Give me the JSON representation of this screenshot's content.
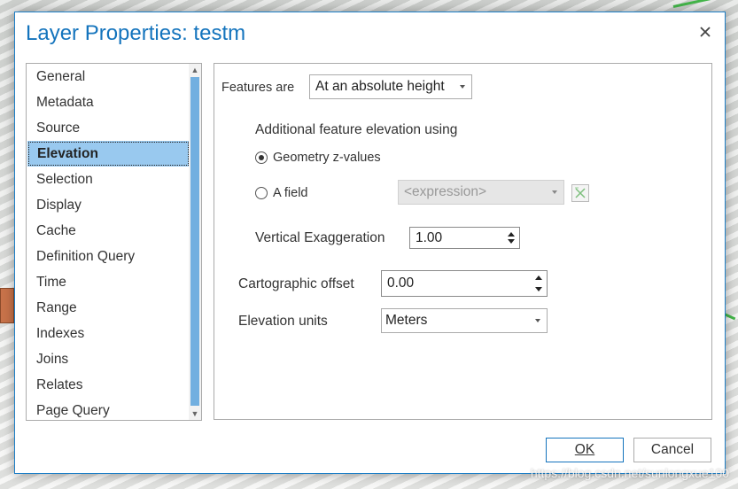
{
  "dialog": {
    "title": "Layer Properties: testm",
    "close_icon": "close-icon"
  },
  "nav": {
    "items": [
      {
        "label": "General"
      },
      {
        "label": "Metadata"
      },
      {
        "label": "Source"
      },
      {
        "label": "Elevation",
        "selected": true
      },
      {
        "label": "Selection"
      },
      {
        "label": "Display"
      },
      {
        "label": "Cache"
      },
      {
        "label": "Definition Query"
      },
      {
        "label": "Time"
      },
      {
        "label": "Range"
      },
      {
        "label": "Indexes"
      },
      {
        "label": "Joins"
      },
      {
        "label": "Relates"
      },
      {
        "label": "Page Query"
      }
    ]
  },
  "elevation": {
    "features_are_label": "Features are",
    "features_are_value": "At an absolute height",
    "additional_label": "Additional feature elevation using",
    "option_geometry": "Geometry z-values",
    "option_field": "A field",
    "field_placeholder": "<expression>",
    "vertical_exaggeration_label": "Vertical Exaggeration",
    "vertical_exaggeration_value": "1.00",
    "cartographic_offset_label": "Cartographic offset",
    "cartographic_offset_value": "0.00",
    "elevation_units_label": "Elevation units",
    "elevation_units_value": "Meters"
  },
  "buttons": {
    "ok": "OK",
    "cancel": "Cancel"
  },
  "colors": {
    "accent": "#1474bd",
    "selected_bg": "#99c9ef",
    "scroll_thumb": "#71afe0"
  },
  "watermark": "https://blog.csdn.net/sunlongxue100"
}
